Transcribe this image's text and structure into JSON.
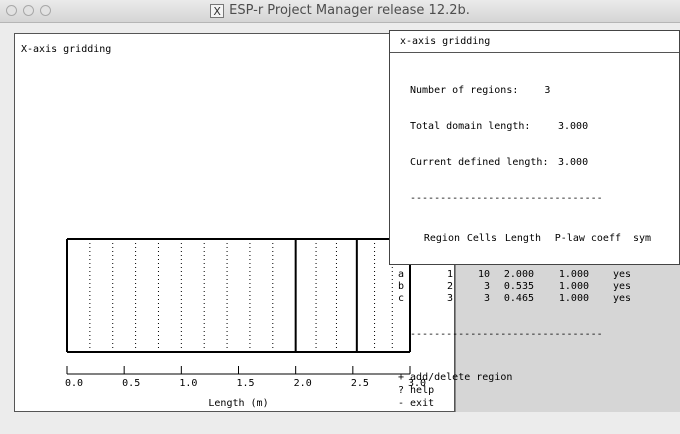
{
  "window": {
    "title": "ESP-r Project Manager release 12.2b.",
    "title_icon": "X"
  },
  "graph": {
    "label": "X-axis gridding",
    "xlabel": "Length (m)",
    "ticks": [
      "0.0",
      "0.5",
      "1.0",
      "1.5",
      "2.0",
      "2.5",
      "3.0"
    ],
    "xlim": [
      0,
      3.0
    ],
    "regions": [
      {
        "start": 0.0,
        "length": 2.0,
        "cells": 10
      },
      {
        "start": 2.0,
        "length": 0.535,
        "cells": 3
      },
      {
        "start": 2.535,
        "length": 0.465,
        "cells": 3
      }
    ]
  },
  "dialog": {
    "title": "x-axis gridding",
    "number_of_regions_label": "Number of regions:",
    "number_of_regions": "3",
    "total_length_label": "Total domain length:",
    "total_length": "3.000",
    "current_length_label": "Current defined length:",
    "current_length": "3.000",
    "separator": "--------------------------------",
    "headers": [
      "Region",
      "Cells",
      "Length",
      "P-law coeff",
      "sym"
    ],
    "rows": [
      {
        "key": "a",
        "region": "1",
        "cells": "10",
        "length": "2.000",
        "coeff": "1.000",
        "sym": "yes"
      },
      {
        "key": "b",
        "region": "2",
        "cells": "3",
        "length": "0.535",
        "coeff": "1.000",
        "sym": "yes"
      },
      {
        "key": "c",
        "region": "3",
        "cells": "3",
        "length": "0.465",
        "coeff": "1.000",
        "sym": "yes"
      }
    ],
    "menu": [
      {
        "key": "+",
        "label": "add/delete region"
      },
      {
        "key": "?",
        "label": "help"
      },
      {
        "key": "-",
        "label": "exit"
      }
    ]
  }
}
